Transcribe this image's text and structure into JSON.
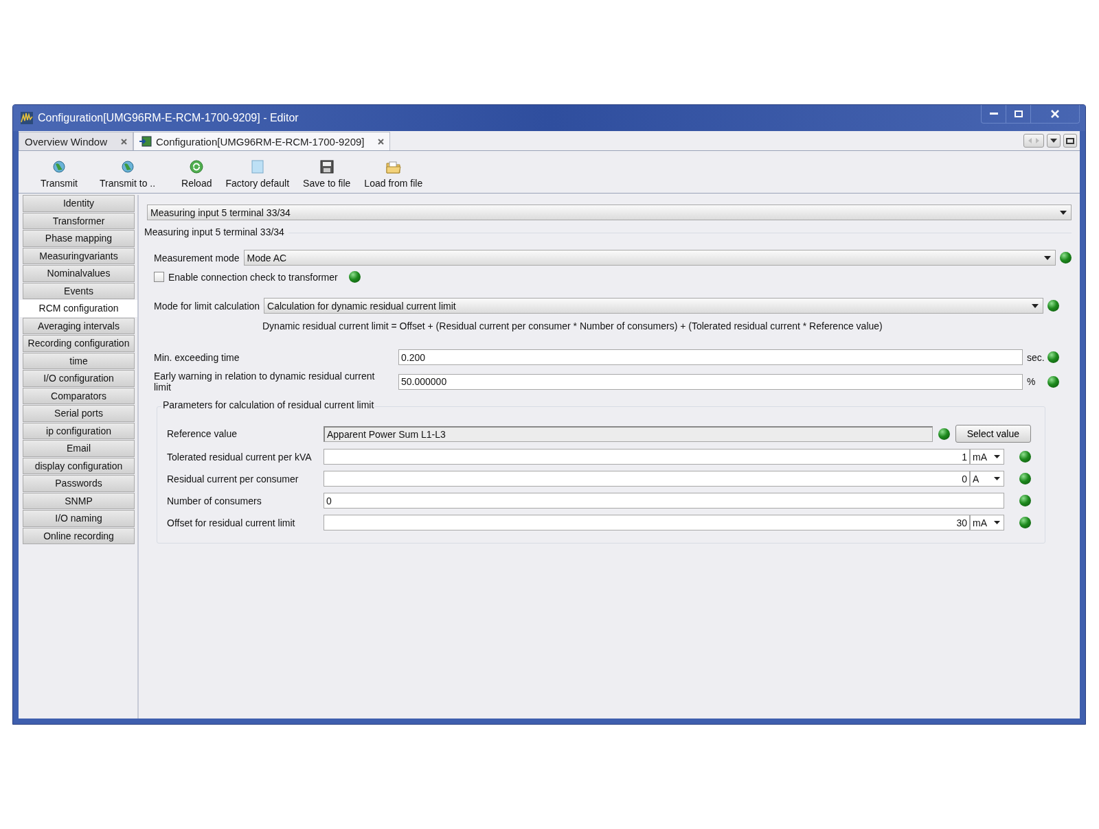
{
  "window": {
    "title": "Configuration[UMG96RM-E-RCM-1700-9209] - Editor"
  },
  "tabs": [
    {
      "label": "Overview Window",
      "selected": false
    },
    {
      "label": "Configuration[UMG96RM-E-RCM-1700-9209]",
      "selected": true
    }
  ],
  "toolbar": [
    "Transmit",
    "Transmit to ..",
    "Reload",
    "Factory default",
    "Save to file",
    "Load from file"
  ],
  "sidebar": {
    "items": [
      {
        "label": "Identity",
        "selected": false
      },
      {
        "label": "Transformer",
        "selected": false
      },
      {
        "label": "Phase mapping",
        "selected": false
      },
      {
        "label": "Measuringvariants",
        "selected": false
      },
      {
        "label": "Nominalvalues",
        "selected": false
      },
      {
        "label": "Events",
        "selected": false
      },
      {
        "label": "RCM configuration",
        "selected": true
      },
      {
        "label": "Averaging intervals",
        "selected": false
      },
      {
        "label": "Recording configuration",
        "selected": false
      },
      {
        "label": "time",
        "selected": false
      },
      {
        "label": "I/O configuration",
        "selected": false
      },
      {
        "label": "Comparators",
        "selected": false
      },
      {
        "label": "Serial ports",
        "selected": false
      },
      {
        "label": "ip configuration",
        "selected": false
      },
      {
        "label": "Email",
        "selected": false
      },
      {
        "label": "display configuration",
        "selected": false
      },
      {
        "label": "Passwords",
        "selected": false
      },
      {
        "label": "SNMP",
        "selected": false
      },
      {
        "label": "I/O naming",
        "selected": false
      },
      {
        "label": "Online recording",
        "selected": false
      }
    ]
  },
  "input_select": {
    "value": "Measuring input 5 terminal 33/34"
  },
  "group": {
    "title": "Measuring input 5 terminal 33/34",
    "measurement_mode": {
      "label": "Measurement mode",
      "value": "Mode AC"
    },
    "connection_check": {
      "label": "Enable connection check to transformer",
      "checked": false
    },
    "limit_mode": {
      "label": "Mode for limit calculation",
      "value": "Calculation for dynamic residual current limit"
    },
    "formula": "Dynamic residual current limit = Offset + (Residual current per consumer * Number of consumers) + (Tolerated residual current * Reference value)",
    "min_exceeding_time": {
      "label": "Min. exceeding time",
      "value": "0.200",
      "unit": "sec."
    },
    "early_warning": {
      "label": "Early warning in relation to dynamic residual current limit",
      "value": "50.000000",
      "unit": "%"
    },
    "parameters": {
      "title": "Parameters for calculation of residual current limit",
      "rows": [
        {
          "kind": "reference",
          "label": "Reference value",
          "value": "Apparent Power Sum L1-L3",
          "button": "Select value"
        },
        {
          "kind": "unit",
          "label": "Tolerated residual current per kVA",
          "value": "1",
          "unit": "mA"
        },
        {
          "kind": "unit",
          "label": "Residual current per consumer",
          "value": "0",
          "unit": "A"
        },
        {
          "kind": "text",
          "label": "Number of consumers",
          "value": "0"
        },
        {
          "kind": "unit",
          "label": "Offset for residual current limit",
          "value": "30",
          "unit": "mA"
        }
      ]
    }
  }
}
